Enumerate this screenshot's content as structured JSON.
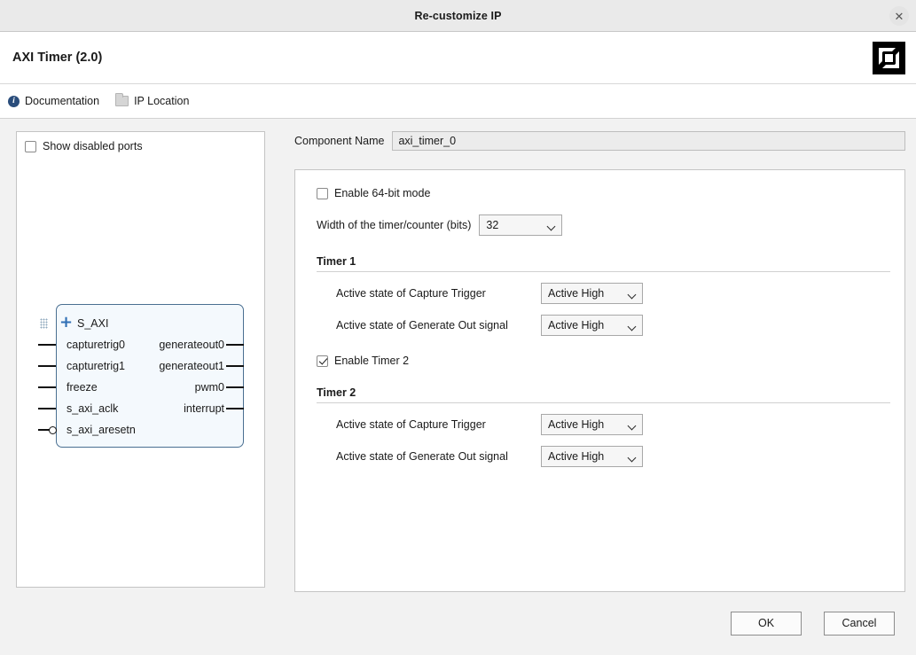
{
  "window": {
    "title": "Re-customize IP",
    "close_label": "✕"
  },
  "ip_header": {
    "title": "AXI Timer (2.0)",
    "logo": "xilinx-logo"
  },
  "linkbar": {
    "items": [
      {
        "label": "Documentation",
        "icon": "info-icon"
      },
      {
        "label": "IP Location",
        "icon": "folder-icon"
      }
    ]
  },
  "left_panel": {
    "show_disabled_ports": {
      "label": "Show disabled ports",
      "checked": false
    },
    "diagram": {
      "bus_port": {
        "label": "S_AXI",
        "expander": "+"
      },
      "left_ports": [
        {
          "label": "capturetrig0",
          "inverted": false
        },
        {
          "label": "capturetrig1",
          "inverted": false
        },
        {
          "label": "freeze",
          "inverted": false
        },
        {
          "label": "s_axi_aclk",
          "inverted": false
        },
        {
          "label": "s_axi_aresetn",
          "inverted": true
        }
      ],
      "right_ports": [
        {
          "label": "generateout0"
        },
        {
          "label": "generateout1"
        },
        {
          "label": "pwm0"
        },
        {
          "label": "interrupt"
        }
      ]
    }
  },
  "component_name": {
    "label": "Component Name",
    "value": "axi_timer_0"
  },
  "options": {
    "enable_64bit": {
      "label": "Enable 64-bit mode",
      "checked": false
    },
    "width": {
      "label": "Width of the timer/counter (bits)",
      "value": "32"
    },
    "timer1": {
      "heading": "Timer 1",
      "capture_trigger": {
        "label": "Active state of Capture Trigger",
        "value": "Active High"
      },
      "generate_out": {
        "label": "Active state of Generate Out signal",
        "value": "Active High"
      }
    },
    "enable_timer2": {
      "label": "Enable Timer 2",
      "checked": true
    },
    "timer2": {
      "heading": "Timer 2",
      "capture_trigger": {
        "label": "Active state of Capture Trigger",
        "value": "Active High"
      },
      "generate_out": {
        "label": "Active state of Generate Out signal",
        "value": "Active High"
      }
    }
  },
  "footer": {
    "ok_label": "OK",
    "cancel_label": "Cancel"
  },
  "colors": {
    "accent_blue": "#2f6fb5",
    "block_border": "#4a6f91",
    "block_fill": "#f4f9fd",
    "window_bg": "#f2f2f2"
  }
}
